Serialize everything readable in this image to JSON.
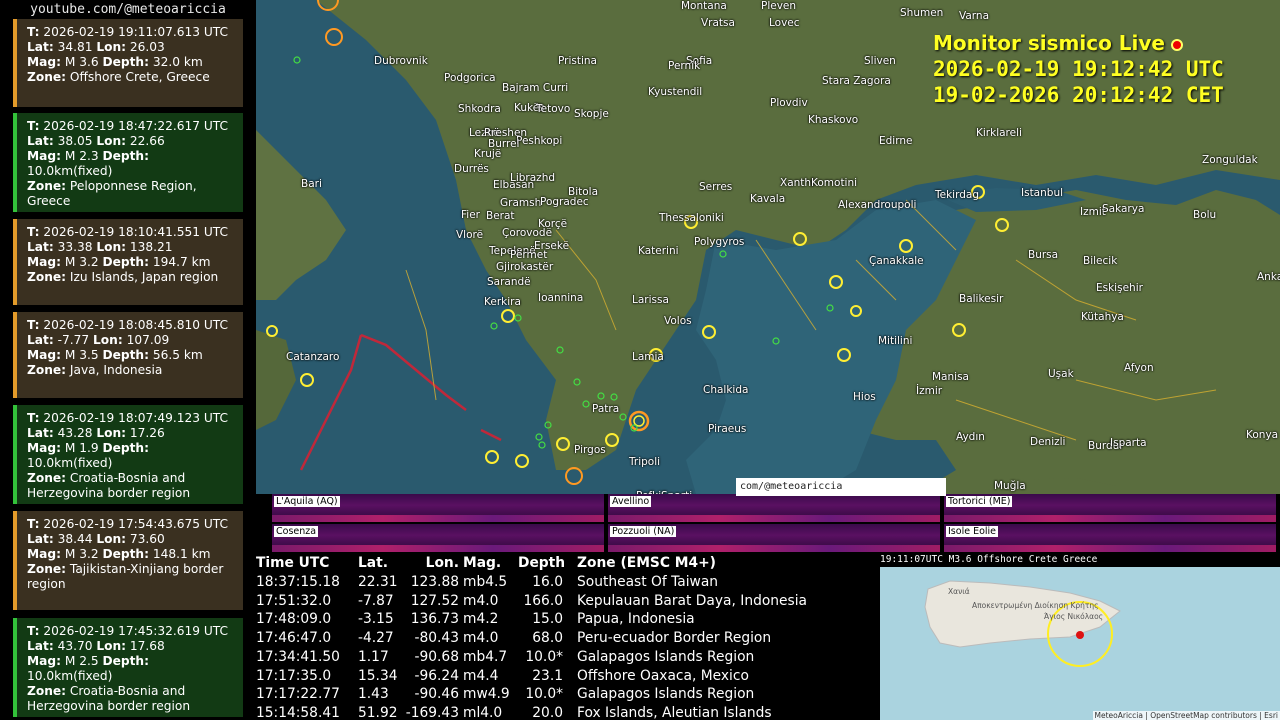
{
  "sidebar": {
    "channel": "youtube.com/@meteoariccia",
    "labels": {
      "time": "T:",
      "lat": "Lat:",
      "lon": "Lon:",
      "mag": "Mag:",
      "depth": "Depth:",
      "zone": "Zone:"
    },
    "events": [
      {
        "t": "2026-02-19  19:11:07.613 UTC",
        "lat": "34.81",
        "lon": "26.03",
        "mag": "M 3.6",
        "depth": "32.0 km",
        "zone": "Offshore Crete, Greece",
        "color": "orange"
      },
      {
        "t": "2026-02-19  18:47:22.617 UTC",
        "lat": "38.05",
        "lon": "22.66",
        "mag": "M 2.3",
        "depth": "10.0km(fixed)",
        "zone": "Peloponnese Region, Greece",
        "color": "green"
      },
      {
        "t": "2026-02-19  18:10:41.551 UTC",
        "lat": "33.38",
        "lon": "138.21",
        "mag": "M 3.2",
        "depth": "194.7 km",
        "zone": "Izu Islands, Japan region",
        "color": "orange"
      },
      {
        "t": "2026-02-19  18:08:45.810 UTC",
        "lat": "-7.77",
        "lon": "107.09",
        "mag": "M 3.5",
        "depth": "56.5 km",
        "zone": "Java, Indonesia",
        "color": "orange"
      },
      {
        "t": "2026-02-19  18:07:49.123 UTC",
        "lat": "43.28",
        "lon": "17.26",
        "mag": "M 1.9",
        "depth": "10.0km(fixed)",
        "zone": "Croatia-Bosnia and Herzegovina border region",
        "color": "green"
      },
      {
        "t": "2026-02-19  17:54:43.675 UTC",
        "lat": "38.44",
        "lon": "73.60",
        "mag": "M 3.2",
        "depth": "148.1 km",
        "zone": "Tajikistan-Xinjiang border region",
        "color": "orange"
      },
      {
        "t": "2026-02-19  17:45:32.619 UTC",
        "lat": "43.70",
        "lon": "17.68",
        "mag": "M 2.5",
        "depth": "10.0km(fixed)",
        "zone": "Croatia-Bosnia and Herzegovina border region",
        "color": "green"
      }
    ]
  },
  "header": {
    "title": "Monitor sismico Live",
    "utc_line": "2026-02-19  19:12:42  UTC",
    "cet_line": "19-02-2026  20:12:42  CET"
  },
  "map": {
    "places": [
      "Montana",
      "Vratsa",
      "Pleven",
      "Lovec",
      "Shumen",
      "Varna",
      "Dubrovnik",
      "Pristina",
      "Sofia",
      "Pernik",
      "Sliven",
      "Podgorica",
      "Bajram Curri",
      "Stara Zagora",
      "Shkodra",
      "Kukës",
      "Tetovo",
      "Skopje",
      "Kyustendil",
      "Plovdiv",
      "Lezhë",
      "Rreshen",
      "Peshkopi",
      "Khaskovo",
      "Krujë",
      "Burrel",
      "Edirne",
      "Kirklareli",
      "Zonguldak",
      "Durrës",
      "Elbasan",
      "Librazhd",
      "Bitola",
      "Bari",
      "Fier",
      "Berat",
      "Gramsh",
      "Pogradec",
      "Serres",
      "Kavala",
      "Xanthi",
      "Komotini",
      "Tekirdag",
      "Istanbul",
      "Izmit",
      "Sakarya",
      "Bolu",
      "Vlorë",
      "Çorovodë",
      "Korçë",
      "Thessaloniki",
      "Alexandroupoli",
      "Tepelenë",
      "Përmet",
      "Ersekë",
      "Gjirokastër",
      "Sarandë",
      "Katerini",
      "Polygyros",
      "Çanakkale",
      "Bursa",
      "Bilecik",
      "Eskişehir",
      "Ioannina",
      "Kerkira",
      "Larissa",
      "Balikesir",
      "Kütahya",
      "Volos",
      "Mitilini",
      "Catanzaro",
      "Lamia",
      "Manisa",
      "Uşak",
      "Afyon",
      "Chalkida",
      "İzmir",
      "Hios",
      "Patra",
      "Piraeus",
      "Aydın",
      "Denizli",
      "Burdur",
      "Isparta",
      "Konya",
      "Pirgos",
      "Tripoli",
      "Muğla",
      "Ankara",
      "Pefki",
      "Sparti"
    ],
    "colors": {
      "sea": "#2a5a6e",
      "land": "#5f7040",
      "quake_recent": "#ffee33",
      "quake_old": "#44dd44",
      "latest": "#ff9922",
      "fault": "#c0283a"
    }
  },
  "spectrograms": [
    {
      "station": "L'Aquila (AQ)"
    },
    {
      "station": "Avellino"
    },
    {
      "station": "Tortorici (ME)"
    },
    {
      "station": "Cosenza"
    },
    {
      "station": "Pozzuoli (NA)"
    },
    {
      "station": "Isole Eolie"
    }
  ],
  "overlay_caption": "com/@meteoariccia",
  "table": {
    "headers": [
      "Time UTC",
      "Lat.",
      "Lon.",
      "Mag.",
      "Depth",
      "Zone (EMSC M4+)"
    ],
    "rows": [
      [
        "18:37:15.18",
        "22.31",
        "123.88",
        "mb4.5",
        "16.0",
        "Southeast Of Taiwan"
      ],
      [
        "17:51:32.0",
        "-7.87",
        "127.52",
        "m4.0",
        "166.0",
        "Kepulauan Barat Daya, Indonesia"
      ],
      [
        "17:48:09.0",
        "-3.15",
        "136.73",
        "m4.2",
        "15.0",
        "Papua, Indonesia"
      ],
      [
        "17:46:47.0",
        "-4.27",
        "-80.43",
        "m4.0",
        "68.0",
        "Peru-ecuador Border Region"
      ],
      [
        "17:34:41.50",
        "1.17",
        "-90.68",
        "mb4.7",
        "10.0*",
        "Galapagos Islands Region"
      ],
      [
        "17:17:35.0",
        "15.34",
        "-96.24",
        "m4.4",
        "23.1",
        "Offshore Oaxaca, Mexico"
      ],
      [
        "17:17:22.77",
        "1.43",
        "-90.46",
        "mw4.9",
        "10.0*",
        "Galapagos Islands Region"
      ],
      [
        "15:14:58.41",
        "51.92",
        "-169.43",
        "ml4.0",
        "20.0",
        "Fox Islands, Aleutian Islands"
      ]
    ]
  },
  "inset": {
    "title": "19:11:07UTC  M3.6  Offshore Crete Greece",
    "places": [
      "Χανιά",
      "Αποκεντρωμένη Διοίκηση Κρήτης",
      "Άγιος Νικόλαος"
    ],
    "attribution": "MeteoAriccia | OpenStreetMap contributors | Esri"
  }
}
